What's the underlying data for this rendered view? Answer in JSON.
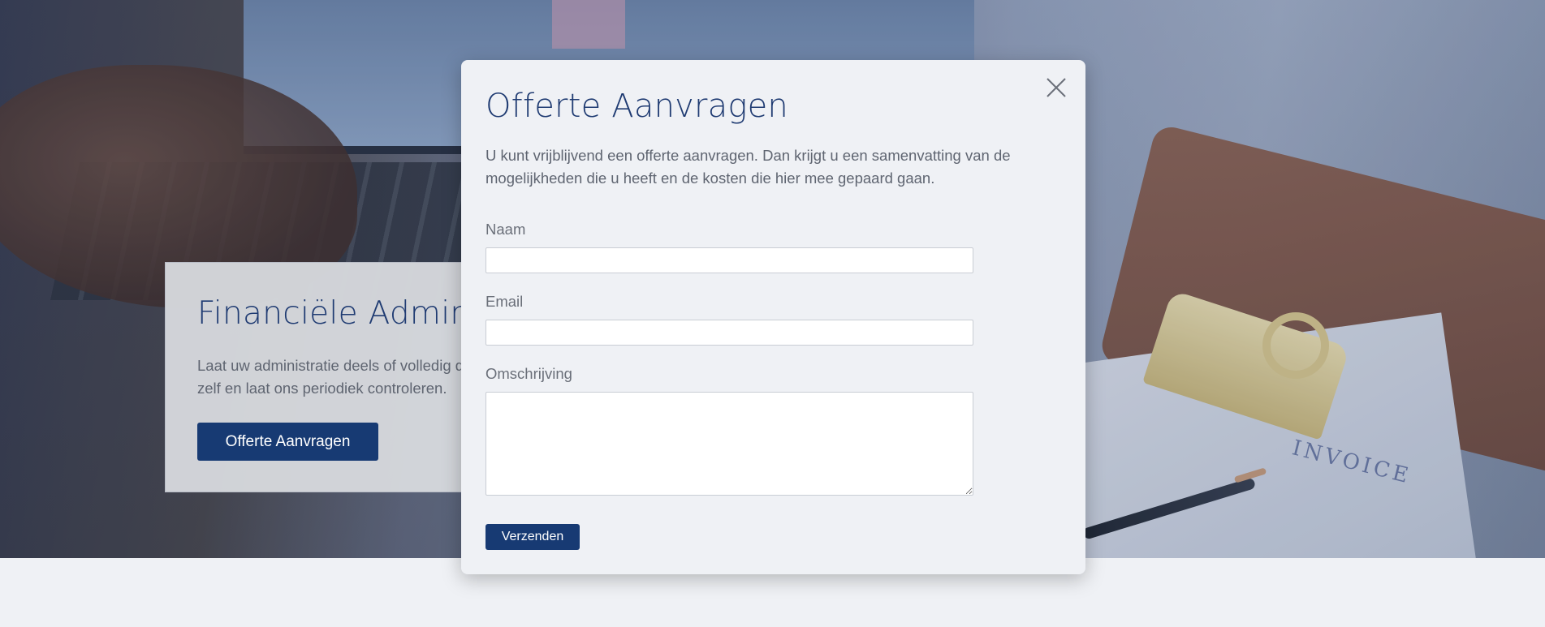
{
  "hero": {
    "title": "Financiële Administratie",
    "description": "Laat uw administratie deels of volledig door ons verzorgen, of doe het zelf en laat ons periodiek controleren.",
    "cta_label": "Offerte Aanvragen",
    "invoice_text": "INVOICE"
  },
  "modal": {
    "title": "Offerte Aanvragen",
    "intro": "U kunt vrijblijvend een offerte aanvragen. Dan krijgt u een samenvatting van de mogelijkheden die u heeft en de kosten die hier mee gepaard gaan.",
    "close_icon": "close-icon",
    "fields": {
      "name_label": "Naam",
      "name_value": "",
      "email_label": "Email",
      "email_value": "",
      "description_label": "Omschrijving",
      "description_value": ""
    },
    "submit_label": "Verzenden"
  },
  "colors": {
    "primary": "#173a73",
    "heading": "#1f3b72",
    "body_text": "#5f6571",
    "page_bg": "#eff1f5"
  }
}
